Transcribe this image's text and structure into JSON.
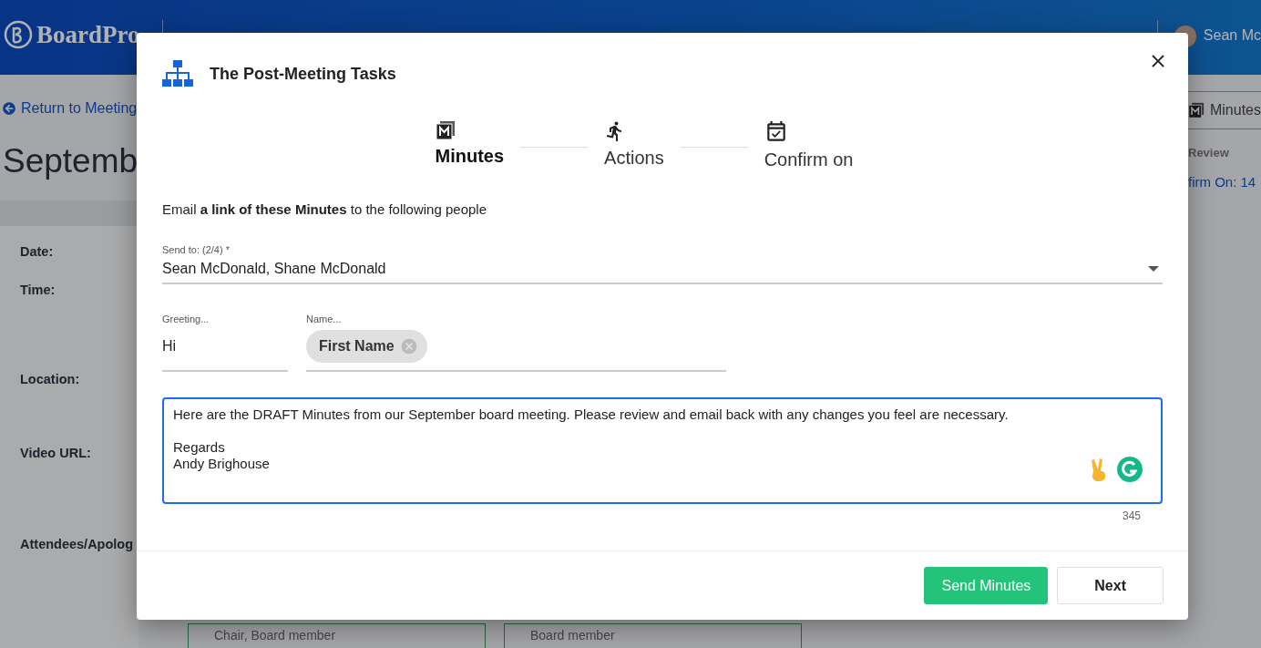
{
  "header": {
    "logo": "BoardPro",
    "user": "Sean Mc"
  },
  "page": {
    "back_link": "Return to Meeting",
    "title": "Septemb",
    "fields": [
      "Date:",
      "Time:",
      "Location:",
      "Video URL:",
      "Attendees/Apolog"
    ],
    "attendee_roles": [
      "Chair, Board member",
      "Board member"
    ],
    "side_tab": "Minutes",
    "side_heading": "Review",
    "side_link": "firm On: 14"
  },
  "dialog": {
    "title": "The Post-Meeting Tasks",
    "steps": [
      {
        "label": "Minutes",
        "selected": true
      },
      {
        "label": "Actions",
        "selected": false
      },
      {
        "label": "Confirm on",
        "selected": false
      }
    ],
    "intro": "Email **a link of these Minutes** to the following people",
    "send_to": {
      "label": "Send to: (2/4) *",
      "value": "Sean McDonald, Shane McDonald"
    },
    "greeting": {
      "label": "Greeting...",
      "value": "Hi"
    },
    "name": {
      "label": "Name...",
      "chips": [
        "First Name"
      ]
    },
    "message": {
      "body": "Here are the DRAFT Minutes from our September board meeting. Please review and email back with any changes you feel are necessary.",
      "signature": [
        "Regards",
        "Andy Brighouse"
      ]
    },
    "counter": "345",
    "buttons": {
      "primary": "Send Minutes",
      "secondary": "Next"
    }
  }
}
